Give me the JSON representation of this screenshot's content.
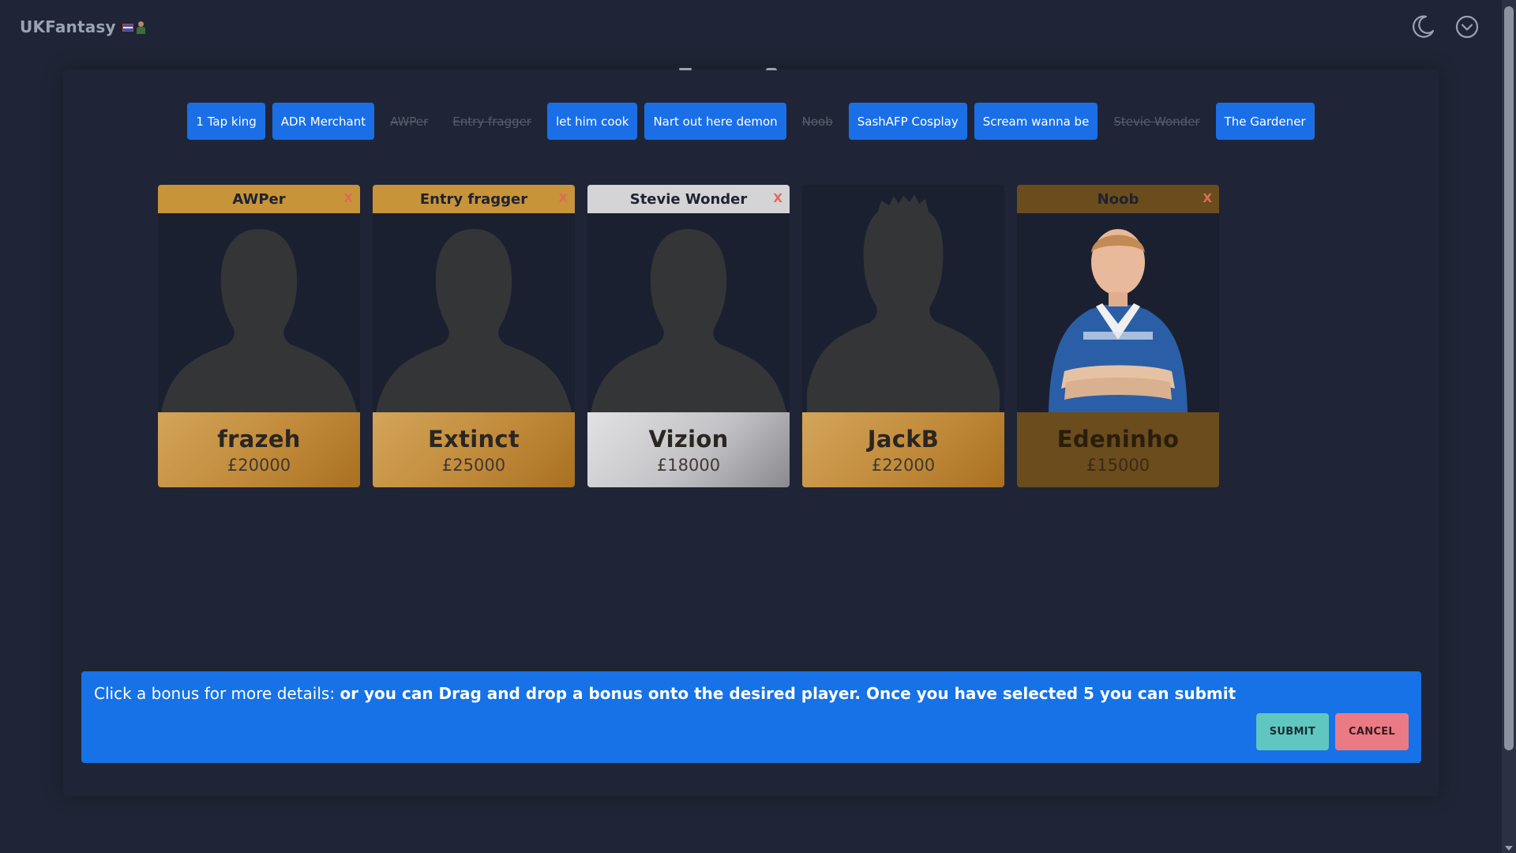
{
  "header": {
    "title": "UKFantasy",
    "icons": [
      "flag-icon",
      "character-icon",
      "moon-icon",
      "chevron-down-circle-icon"
    ]
  },
  "bonuses": [
    {
      "label": "1 Tap king",
      "used": false
    },
    {
      "label": "ADR Merchant",
      "used": false
    },
    {
      "label": "AWPer",
      "used": true
    },
    {
      "label": "Entry fragger",
      "used": true
    },
    {
      "label": "let him cook",
      "used": false
    },
    {
      "label": "Nart out here demon",
      "used": false
    },
    {
      "label": "Noob",
      "used": true
    },
    {
      "label": "SashAFP Cosplay",
      "used": false
    },
    {
      "label": "Scream wanna be",
      "used": false
    },
    {
      "label": "Stevie Wonder",
      "used": true
    },
    {
      "label": "The Gardener",
      "used": false
    }
  ],
  "players": [
    {
      "bonus": "AWPer",
      "name": "frazeh",
      "price": "£20000",
      "tier": "gold",
      "remove": "X"
    },
    {
      "bonus": "Entry fragger",
      "name": "Extinct",
      "price": "£25000",
      "tier": "gold",
      "remove": "X"
    },
    {
      "bonus": "Stevie Wonder",
      "name": "Vizion",
      "price": "£18000",
      "tier": "silver",
      "remove": "X"
    },
    {
      "bonus": "",
      "name": "JackB",
      "price": "£22000",
      "tier": "gold",
      "remove": ""
    },
    {
      "bonus": "Noob",
      "name": "Edeninho",
      "price": "£15000",
      "tier": "dark",
      "remove": "X"
    }
  ],
  "info": {
    "lead": "Click a bonus for more details: ",
    "bold": "or you can Drag and drop a bonus onto the desired player. Once you have selected 5 you can submit",
    "submit_label": "SUBMIT",
    "cancel_label": "CANCEL"
  },
  "colors": {
    "background": "#1f2536",
    "accent": "#1a6fe6",
    "gold": "#c8943a",
    "silver": "#d4d4d6",
    "submit": "#5fc7bf",
    "cancel": "#ea7b85"
  }
}
